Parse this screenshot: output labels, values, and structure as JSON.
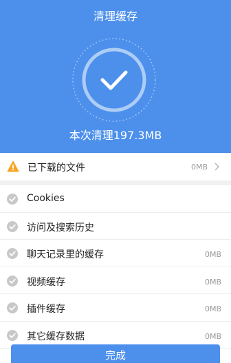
{
  "header": {
    "title": "清理缓存",
    "result_text": "本次清理197.3MB"
  },
  "downloaded": {
    "label": "已下载的文件",
    "size": "0MB"
  },
  "items": [
    {
      "label": "Cookies",
      "size": ""
    },
    {
      "label": "访问及搜索历史",
      "size": ""
    },
    {
      "label": "聊天记录里的缓存",
      "size": "0MB"
    },
    {
      "label": "视频缓存",
      "size": "0MB"
    },
    {
      "label": "插件缓存",
      "size": "0MB"
    },
    {
      "label": "其它缓存数据",
      "size": "0MB"
    }
  ],
  "footer": {
    "done_label": "完成"
  },
  "colors": {
    "primary": "#4d90ec",
    "warning": "#f5a623",
    "check_gray": "#c8c8c8"
  }
}
